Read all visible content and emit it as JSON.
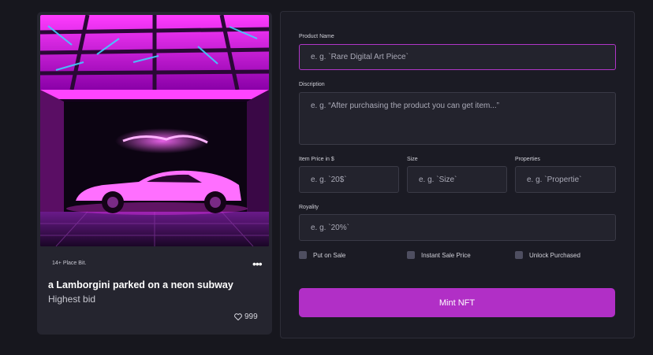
{
  "card": {
    "bid_small": "14+ Place Bit.",
    "title": "a Lamborgini parked on a neon subway",
    "subtitle": "Highest bid",
    "likes": "999",
    "more_icon": "ellipsis-icon",
    "heart_icon": "heart-icon"
  },
  "form": {
    "product_name": {
      "label": "Product Name",
      "placeholder": "e. g. `Rare Digital Art Piece`"
    },
    "description": {
      "label": "Discription",
      "placeholder": "e. g. “After purchasing the product you can get item...”"
    },
    "price": {
      "label": "Item Price in $",
      "placeholder": "e. g. `20$`"
    },
    "size": {
      "label": "Size",
      "placeholder": "e. g. `Size`"
    },
    "properties": {
      "label": "Properties",
      "placeholder": "e. g. `Propertie`"
    },
    "royality": {
      "label": "Royality",
      "placeholder": "e. g. `20%`"
    },
    "checkboxes": [
      "Put on Sale",
      "Instant Sale Price",
      "Unlock Purchased"
    ],
    "mint_button": "Mint NFT"
  },
  "colors": {
    "accent": "#b12fc6",
    "panel": "#1b1b24",
    "card": "#25252f",
    "neon": "#ff2bff"
  }
}
